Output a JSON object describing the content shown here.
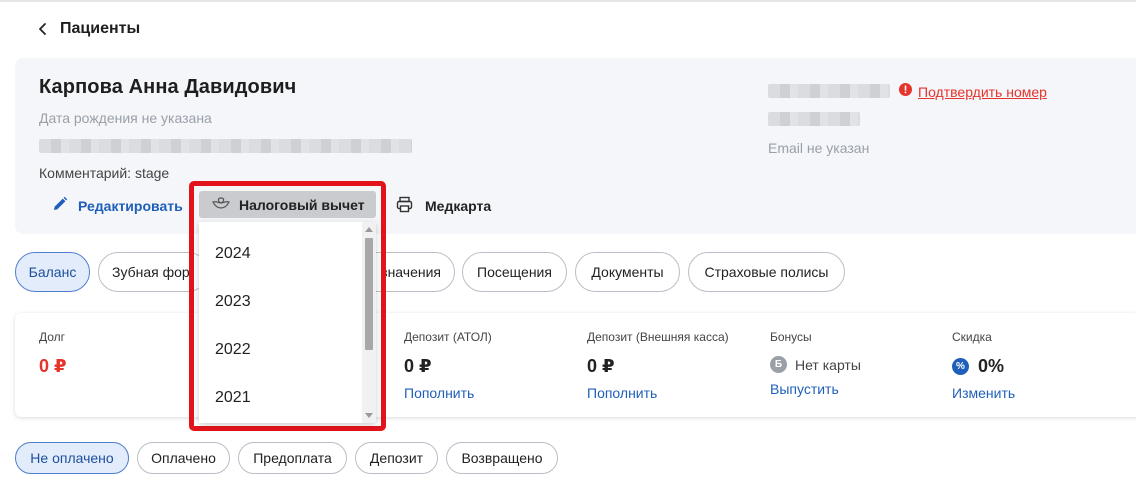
{
  "header": {
    "back_title": "Пациенты"
  },
  "patient": {
    "name": "Карпова Анна Давидович",
    "dob": "Дата рождения не указана",
    "comment": "Комментарий: stage",
    "confirm_phone": "Подтвердить номер",
    "email": "Email не указан"
  },
  "actions": {
    "edit": "Редактировать",
    "tax": "Налоговый вычет",
    "medcard": "Медкарта"
  },
  "tax_dropdown": {
    "years": [
      "2024",
      "2023",
      "2022",
      "2021"
    ]
  },
  "tabs": [
    {
      "label": "Баланс",
      "active": true
    },
    {
      "label": "Зубная фор"
    },
    {
      "label": "значения"
    },
    {
      "label": "Посещения"
    },
    {
      "label": "Документы"
    },
    {
      "label": "Страховые полисы"
    }
  ],
  "stats": {
    "debt": {
      "label": "Долг",
      "value": "0 ₽"
    },
    "deposit_atol": {
      "label": "Депозит (АТОЛ)",
      "value": "0 ₽",
      "link": "Пополнить"
    },
    "deposit_ext": {
      "label": "Депозит (Внешняя касса)",
      "value": "0 ₽",
      "link": "Пополнить"
    },
    "bonuses": {
      "label": "Бонусы",
      "badge": "Б",
      "value": "Нет карты",
      "link": "Выпустить"
    },
    "discount": {
      "label": "Скидка",
      "badge": "%",
      "value": "0%",
      "link": "Изменить"
    }
  },
  "filters": [
    "Не оплачено",
    "Оплачено",
    "Предоплата",
    "Депозит",
    "Возвращено"
  ],
  "colors": {
    "accent": "#1f5fb9",
    "danger": "#e5342a",
    "highlight": "#e3131b",
    "card_bg": "#f4f6fa"
  }
}
